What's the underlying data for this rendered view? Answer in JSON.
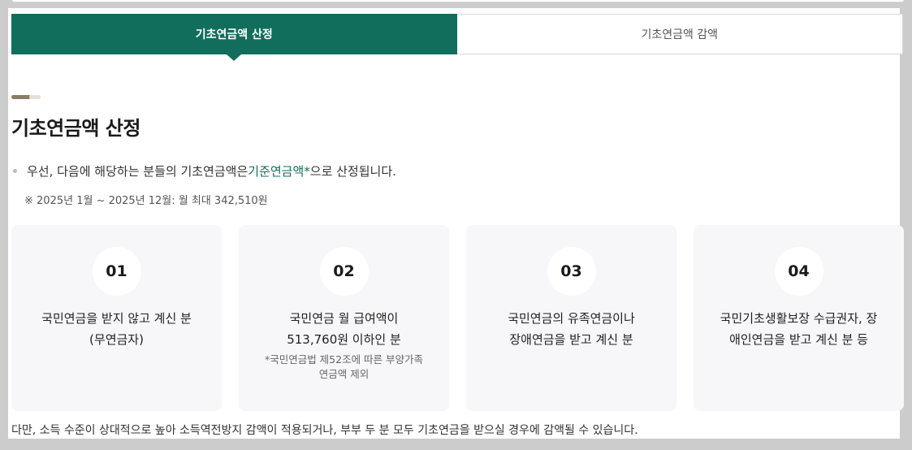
{
  "tabs": [
    {
      "label": "기초연금액 산정",
      "active": true
    },
    {
      "label": "기초연금액 감액",
      "active": false
    }
  ],
  "section": {
    "title": "기초연금액 산정",
    "bullet_prefix": "우선, 다음에 해당하는 분들의 기초연금액은 ",
    "bullet_highlight": "기준연금액*",
    "bullet_suffix": "으로 산정됩니다.",
    "note": "※ 2025년 1월 ~ 2025년 12월: 월 최대 342,510원"
  },
  "cards": [
    {
      "number": "01",
      "line1": "국민연금을 받지 않고 계신 분",
      "line2": "(무연금자)",
      "sub1": "",
      "sub2": ""
    },
    {
      "number": "02",
      "line1": "국민연금 월 급여액이",
      "line2": "513,760원 이하인 분",
      "sub1": "*국민연금법 제52조에 따른 부양가족",
      "sub2": "연금액 제외"
    },
    {
      "number": "03",
      "line1": "국민연금의 유족연금이나",
      "line2": "장애연금을 받고 계신 분",
      "sub1": "",
      "sub2": ""
    },
    {
      "number": "04",
      "line1": "국민기초생활보장 수급권자, 장",
      "line2": "애인연금을 받고 계신 분 등",
      "sub1": "",
      "sub2": ""
    }
  ],
  "footer": "다만, 소득 수준이 상대적으로 높아 소득역전방지 감액이 적용되거나, 부부 두 분 모두 기초연금을 받으실 경우에 감액될 수 있습니다.",
  "colors": {
    "accent": "#126e5c",
    "card_bg": "#f7f7f9"
  }
}
